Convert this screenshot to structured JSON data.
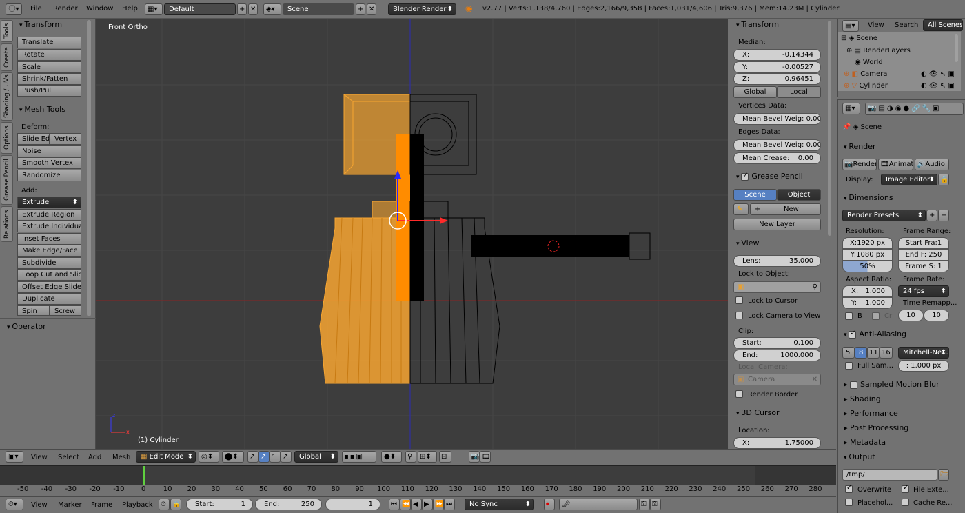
{
  "top_bar": {
    "menus": [
      "File",
      "Render",
      "Window",
      "Help"
    ],
    "screen_layout": "Default",
    "scene": "Scene",
    "engine": "Blender Render",
    "stats": "v2.77 | Verts:1,138/4,760 | Edges:2,166/9,358 | Faces:1,031/4,606 | Tris:9,376 | Mem:14.23M | Cylinder"
  },
  "tool_tabs": [
    "Tools",
    "Create",
    "Shading / UVs",
    "Options",
    "Grease Pencil",
    "Relations"
  ],
  "tools_panel": {
    "transform_title": "Transform",
    "transform_buttons": [
      "Translate",
      "Rotate",
      "Scale",
      "Shrink/Fatten",
      "Push/Pull"
    ],
    "mesh_tools_title": "Mesh Tools",
    "deform_label": "Deform:",
    "slide_edge": "Slide Ed",
    "vertex": "Vertex",
    "deform_buttons": [
      "Noise",
      "Smooth Vertex",
      "Randomize"
    ],
    "add_label": "Add:",
    "extrude": "Extrude",
    "add_buttons": [
      "Extrude Region",
      "Extrude Individual",
      "Inset Faces",
      "Make Edge/Face",
      "Subdivide",
      "Loop Cut and Slide",
      "Offset Edge Slide",
      "Duplicate"
    ],
    "spin": "Spin",
    "screw": "Screw",
    "operator_title": "Operator"
  },
  "viewport": {
    "view_name": "Front Ortho",
    "object_label": "(1) Cylinder",
    "axis_z": "z",
    "axis_x": "x"
  },
  "n_panel": {
    "transform_title": "Transform",
    "median_label": "Median:",
    "x_label": "X:",
    "x_value": "-0.14344",
    "y_label": "Y:",
    "y_value": "-0.00527",
    "z_label": "Z:",
    "z_value": "0.96451",
    "global": "Global",
    "local": "Local",
    "vertices_data": "Vertices Data:",
    "mean_bevel_weight_v": "Mean Bevel Weig: 0.00",
    "edges_data": "Edges Data:",
    "mean_bevel_weight_e": "Mean Bevel Weig: 0.00",
    "mean_crease_label": "Mean Crease:",
    "mean_crease_value": "0.00",
    "grease_pencil_title": "Grease Pencil",
    "scene": "Scene",
    "object": "Object",
    "new": "New",
    "new_layer": "New Layer",
    "view_title": "View",
    "lens_label": "Lens:",
    "lens_value": "35.000",
    "lock_to_object": "Lock to Object:",
    "lock_to_cursor": "Lock to Cursor",
    "lock_camera_to_view": "Lock Camera to View",
    "clip_label": "Clip:",
    "start_label": "Start:",
    "start_value": "0.100",
    "end_label": "End:",
    "end_value": "1000.000",
    "local_camera": "Local Camera:",
    "camera": "Camera",
    "render_border": "Render Border",
    "cursor_title": "3D Cursor",
    "location_label": "Location:",
    "cursor_x_label": "X:",
    "cursor_x_value": "1.75000"
  },
  "outliner": {
    "view": "View",
    "search": "Search",
    "all_scenes": "All Scenes",
    "items": [
      "Scene",
      "RenderLayers",
      "World",
      "Camera",
      "Cylinder"
    ]
  },
  "properties": {
    "scene_crumb": "Scene",
    "render_title": "Render",
    "render_btn": "Render",
    "animation_btn": "Animati",
    "audio_btn": "Audio",
    "display_label": "Display:",
    "display_value": "Image Editor",
    "dimensions_title": "Dimensions",
    "render_presets": "Render Presets",
    "resolution_label": "Resolution:",
    "res_x": "X:1920 px",
    "res_y": "Y:1080 px",
    "res_pct": "50%",
    "frame_range_label": "Frame Range:",
    "start_frame": "Start Fra:1",
    "end_frame": "End F: 250",
    "frame_step": "Frame S: 1",
    "aspect_label": "Aspect Ratio:",
    "aspect_x_label": "X:",
    "aspect_x": "1.000",
    "aspect_y_label": "Y:",
    "aspect_y": "1.000",
    "frame_rate_label": "Frame Rate:",
    "fps": "24 fps",
    "time_remap_label": "Time Remapp...",
    "remap_old": "10",
    "remap_new": "10",
    "b_label": "B",
    "cr_label": "Cr",
    "aa_title": "Anti-Aliasing",
    "aa_samples": [
      "5",
      "8",
      "11",
      "16"
    ],
    "aa_filter": "Mitchell-Ne...",
    "full_sample": "Full Sam...",
    "filter_size": ": 1.000 px",
    "motion_blur_title": "Sampled Motion Blur",
    "shading_title": "Shading",
    "performance_title": "Performance",
    "post_processing_title": "Post Processing",
    "metadata_title": "Metadata",
    "output_title": "Output",
    "output_path": "/tmp/",
    "overwrite": "Overwrite",
    "file_extensions": "File Exte...",
    "placeholders": "Placehol...",
    "cache_result": "Cache Re..."
  },
  "view3d_header": {
    "menus": [
      "View",
      "Select",
      "Add",
      "Mesh"
    ],
    "mode": "Edit Mode",
    "orientation": "Global"
  },
  "timeline": {
    "ticks": [
      "-50",
      "-40",
      "-30",
      "-20",
      "-10",
      "0",
      "10",
      "20",
      "30",
      "40",
      "50",
      "60",
      "70",
      "80",
      "90",
      "100",
      "110",
      "120",
      "130",
      "140",
      "150",
      "160",
      "170",
      "180",
      "190",
      "200",
      "210",
      "220",
      "230",
      "240",
      "250",
      "260",
      "270",
      "280"
    ],
    "menus": [
      "View",
      "Marker",
      "Frame",
      "Playback"
    ],
    "start_label": "Start:",
    "start_value": "1",
    "end_label": "End:",
    "end_value": "250",
    "current_frame": "1",
    "sync": "No Sync"
  },
  "colors": {
    "selected_orange": "#f7a531",
    "viewport_bg": "#3d3d3d",
    "accent_blue": "#5680c2"
  }
}
